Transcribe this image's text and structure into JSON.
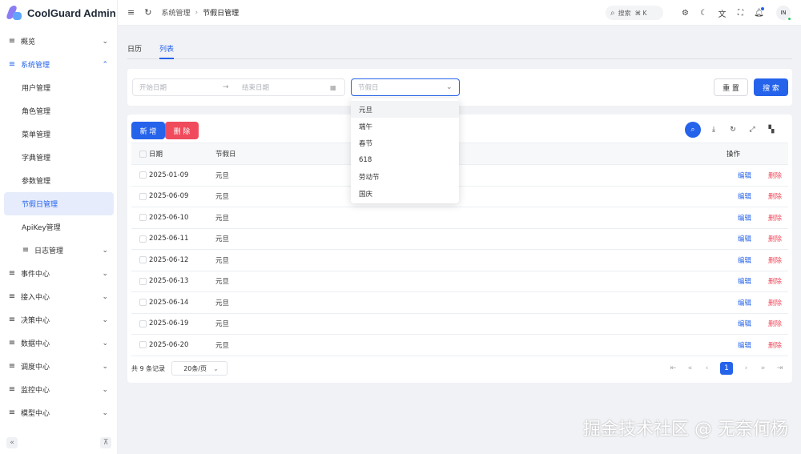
{
  "app": {
    "name": "CoolGuard Admin"
  },
  "sidebar": {
    "items": [
      {
        "label": "概览",
        "icon": "list-icon",
        "chevron": "⌄"
      },
      {
        "label": "系统管理",
        "icon": "list-icon",
        "chevron": "⌃",
        "open": true
      },
      {
        "label": "用户管理"
      },
      {
        "label": "角色管理"
      },
      {
        "label": "菜单管理"
      },
      {
        "label": "字典管理"
      },
      {
        "label": "参数管理"
      },
      {
        "label": "节假日管理",
        "active": true
      },
      {
        "label": "ApiKey管理"
      },
      {
        "label": "日志管理",
        "icon": "list-icon",
        "chevron": "⌄"
      },
      {
        "label": "事件中心",
        "icon": "list-icon",
        "chevron": "⌄"
      },
      {
        "label": "接入中心",
        "icon": "list-icon",
        "chevron": "⌄"
      },
      {
        "label": "决策中心",
        "icon": "list-icon",
        "chevron": "⌄"
      },
      {
        "label": "数据中心",
        "icon": "list-icon",
        "chevron": "⌄"
      },
      {
        "label": "调度中心",
        "icon": "list-icon",
        "chevron": "⌄"
      },
      {
        "label": "监控中心",
        "icon": "list-icon",
        "chevron": "⌄"
      },
      {
        "label": "模型中心",
        "icon": "list-icon",
        "chevron": "⌄"
      }
    ],
    "footer": {
      "collapse_icon": "«",
      "pin_icon": "⊼"
    }
  },
  "header": {
    "breadcrumb": [
      "系统管理",
      "节假日管理"
    ],
    "search": {
      "label": "搜索",
      "shortcut": "⌘ K"
    },
    "avatar_text": "IN"
  },
  "tabs": [
    {
      "label": "日历",
      "active": false
    },
    {
      "label": "列表",
      "active": true
    }
  ],
  "filter": {
    "start_placeholder": "开始日期",
    "end_placeholder": "结束日期",
    "holiday_placeholder": "节假日",
    "reset_label": "重 置",
    "search_label": "搜 索"
  },
  "toolbar": {
    "add_label": "新 增",
    "delete_label": "删 除"
  },
  "table": {
    "columns": {
      "date": "日期",
      "holiday": "节假日",
      "ops": "操作"
    },
    "rows": [
      {
        "date": "2025-01-09",
        "holiday": "元旦"
      },
      {
        "date": "2025-06-09",
        "holiday": "元旦"
      },
      {
        "date": "2025-06-10",
        "holiday": "元旦"
      },
      {
        "date": "2025-06-11",
        "holiday": "元旦"
      },
      {
        "date": "2025-06-12",
        "holiday": "元旦"
      },
      {
        "date": "2025-06-13",
        "holiday": "元旦"
      },
      {
        "date": "2025-06-14",
        "holiday": "元旦"
      },
      {
        "date": "2025-06-19",
        "holiday": "元旦"
      },
      {
        "date": "2025-06-20",
        "holiday": "元旦"
      }
    ],
    "edit_label": "编辑",
    "delete_label": "删除"
  },
  "pagination": {
    "total_text": "共 9 条记录",
    "page_size": "20条/页",
    "current_page": "1"
  },
  "dropdown": {
    "options": [
      "元旦",
      "端午",
      "春节",
      "618",
      "劳动节",
      "国庆"
    ]
  },
  "watermark": "掘金技术社区 @ 无奈何杨",
  "colors": {
    "primary": "#2563eb",
    "danger": "#ef4b5d",
    "bg": "#f1f2f5"
  }
}
